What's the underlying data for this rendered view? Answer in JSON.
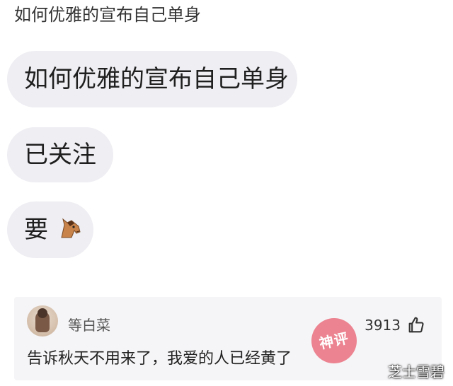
{
  "post": {
    "title": "如何优雅的宣布自己单身"
  },
  "messages": [
    {
      "text": "如何优雅的宣布自己单身"
    },
    {
      "text": "已关注"
    },
    {
      "text": "要",
      "icon": "horse-face-icon"
    }
  ],
  "comment": {
    "username": "等白菜",
    "like_count": "3913",
    "like_icon": "thumbs-up-icon",
    "text": "告诉秋天不用来了，我爱的人已经黄了",
    "stamp_text": "神评"
  },
  "watermark": "芝士雪碧",
  "colors": {
    "bubble_bg": "#eeeef3",
    "card_bg": "#f5f5f7",
    "stamp": "#e85c6e"
  }
}
